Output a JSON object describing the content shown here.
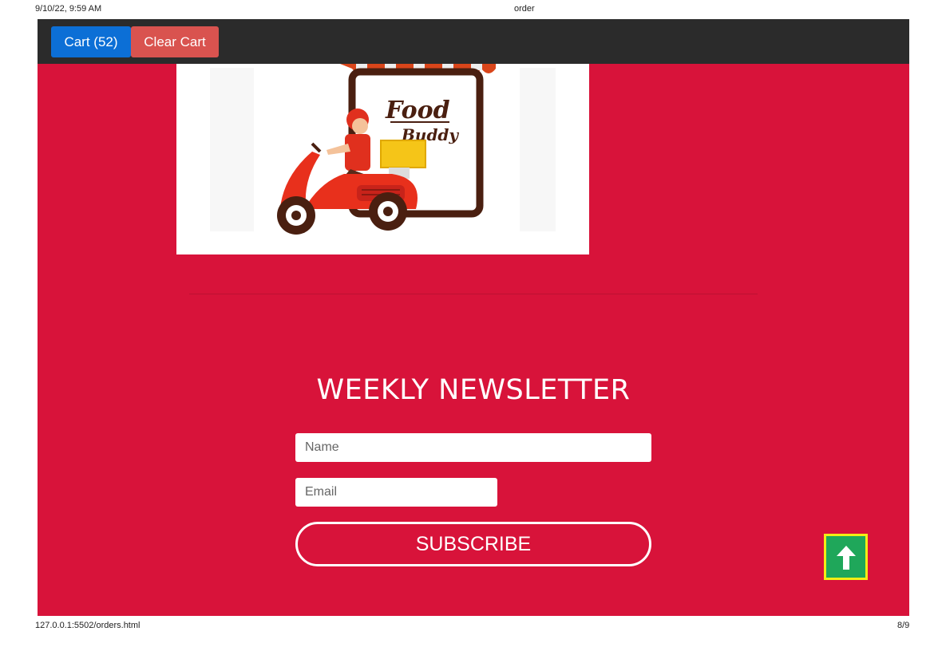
{
  "print": {
    "datetime": "9/10/22, 9:59 AM",
    "title": "order",
    "url": "127.0.0.1:5502/orders.html",
    "page_number": "8/9"
  },
  "navbar": {
    "cart_label": "Cart (52)",
    "clear_label": "Clear Cart"
  },
  "logo": {
    "line1": "Food",
    "line2": "Buddy"
  },
  "newsletter": {
    "title": "WEEKLY NEWSLETTER",
    "name_placeholder": "Name",
    "email_placeholder": "Email",
    "subscribe_label": "SUBSCRIBE"
  },
  "icons": {
    "back_to_top": "arrow-up-icon",
    "logo": "food-delivery-scooter-icon"
  },
  "colors": {
    "page_bg": "#d8133a",
    "navbar_bg": "#2b2b2b",
    "cart_button": "#0c6fd6",
    "clear_button": "#d9534f",
    "back_to_top_bg": "#1fa75a",
    "back_to_top_border": "#f2ee15"
  }
}
